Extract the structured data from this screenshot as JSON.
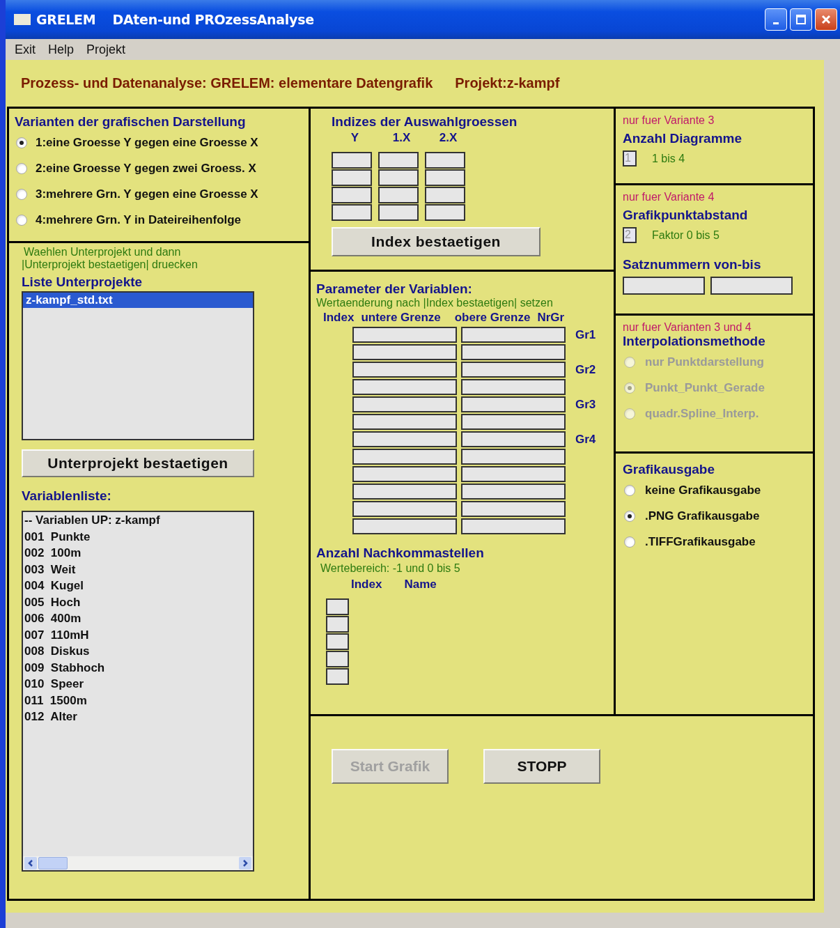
{
  "window": {
    "app": "GRELEM",
    "title": "DAten-und PROzessAnalyse"
  },
  "menu": [
    "Exit",
    "Help",
    "Projekt"
  ],
  "header": {
    "title": "Prozess- und Datenanalyse: GRELEM: elementare Datengrafik",
    "project": "Projekt:z-kampf"
  },
  "variants": {
    "title": "Varianten der grafischen Darstellung",
    "options": [
      {
        "label": "1:eine Groesse Y gegen eine Groesse X",
        "selected": true
      },
      {
        "label": "2:eine Groesse Y gegen zwei Groess. X",
        "selected": false
      },
      {
        "label": "3:mehrere Grn. Y gegen eine Groesse X",
        "selected": false
      },
      {
        "label": "4:mehrere Grn. Y in Dateireihenfolge",
        "selected": false
      }
    ]
  },
  "subprojects": {
    "hint": [
      "Waehlen Unterprojekt und dann",
      "|Unterprojekt bestaetigen|  druecken"
    ],
    "title": "Liste Unterprojekte",
    "items": [
      {
        "label": "z-kampf_std.txt",
        "selected": true
      }
    ],
    "button": "Unterprojekt bestaetigen"
  },
  "variables": {
    "title": "Variablenliste:",
    "items": [
      "-- Variablen UP: z-kampf",
      "001  Punkte",
      "002  100m",
      "003  Weit",
      "004  Kugel",
      "005  Hoch",
      "006  400m",
      "007  110mH",
      "008  Diskus",
      "009  Stabhoch",
      "010  Speer",
      "011  1500m",
      "012  Alter"
    ]
  },
  "indices": {
    "title": "Indizes der Auswahlgroessen",
    "columns": [
      "Y",
      "1.X",
      "2.X"
    ],
    "button": "Index bestaetigen"
  },
  "parameters": {
    "title": "Parameter der Variablen:",
    "hint": "Wertaenderung nach |Index bestaetigen| setzen",
    "columns": [
      "Index",
      "untere Grenze",
      "obere Grenze",
      "NrGr"
    ],
    "groups": [
      "Gr1",
      "Gr2",
      "Gr3",
      "Gr4"
    ]
  },
  "decimals": {
    "title": "Anzahl Nachkommastellen",
    "hint": "Wertebereich: -1 und 0 bis 5",
    "columns": [
      "Index",
      "Name"
    ]
  },
  "diagrams": {
    "note": "nur fuer Variante 3",
    "title": "Anzahl Diagramme",
    "value": "1",
    "range": "1 bis 4"
  },
  "spacing": {
    "note": "nur fuer Variante 4",
    "title": "Grafikpunktabstand",
    "value": "2",
    "range": "Faktor 0 bis 5",
    "records_title": "Satznummern von-bis"
  },
  "interpolation": {
    "note": "nur fuer Varianten 3 und 4",
    "title": "Interpolationsmethode",
    "disabled": true,
    "options": [
      {
        "label": "nur Punktdarstellung",
        "selected": false
      },
      {
        "label": "Punkt_Punkt_Gerade",
        "selected": true
      },
      {
        "label": "quadr.Spline_Interp.",
        "selected": false
      }
    ]
  },
  "output": {
    "title": "Grafikausgabe",
    "options": [
      {
        "label": "keine Grafikausgabe",
        "selected": false
      },
      {
        "label": ".PNG Grafikausgabe",
        "selected": true
      },
      {
        "label": ".TIFFGrafikausgabe",
        "selected": false
      }
    ]
  },
  "buttons": [
    {
      "label": "Start Grafik",
      "disabled": true
    },
    {
      "label": "STOPP",
      "disabled": false
    }
  ]
}
